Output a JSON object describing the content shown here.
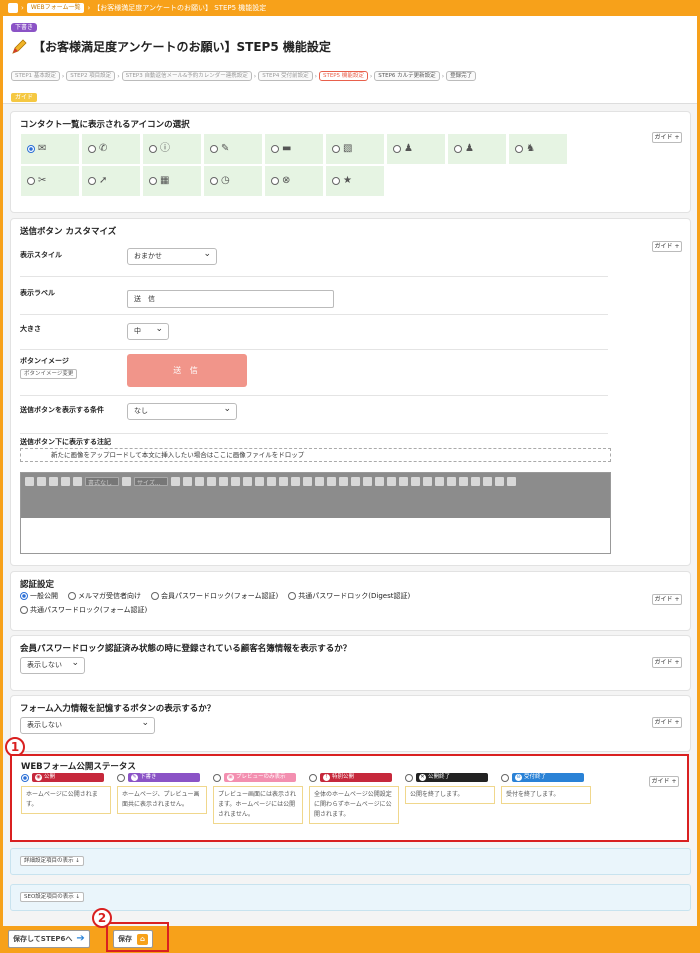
{
  "breadcrumb": {
    "link": "WEBフォーム一覧",
    "current": "【お客様満足度アンケートのお願い】 STEP5 機能設定"
  },
  "header": {
    "badge": "下書き",
    "title": "【お客様満足度アンケートのお願い】STEP5 機能設定",
    "steps": [
      "STEP1 基本設定",
      "STEP2 項目設定",
      "STEP3 自動返信メール&予約カレンダー連携設定",
      "STEP4 受付前設定",
      "STEP5 機能設定",
      "STEP6 カルテ更新設定",
      "登録完了"
    ],
    "guide": "ガイド"
  },
  "guide_label": "ガイド +",
  "icon_section": {
    "title": "コンタクト一覧に表示されるアイコンの選択",
    "icons": [
      "mail-icon",
      "phone-icon",
      "notice-icon",
      "pencil-icon",
      "image-icon",
      "memo-icon",
      "person-icon",
      "person2-icon",
      "people-icon",
      "puzzle-icon",
      "arrow-icon",
      "calendar-icon",
      "clock-icon",
      "cross-circle-icon",
      "star-icon"
    ],
    "glyphs": [
      "✉",
      "✆",
      "ⓘ",
      "✎",
      "▬",
      "▧",
      "♟",
      "♟",
      "♞",
      "✂",
      "➚",
      "▦",
      "◷",
      "⊗",
      "★"
    ],
    "selected_index": 0
  },
  "button_section": {
    "title": "送信ボタン カスタマイズ",
    "style_label": "表示スタイル",
    "style_value": "おまかせ",
    "text_label": "表示ラベル",
    "text_value": "送　信",
    "size_label": "大きさ",
    "size_value": "中",
    "image_label": "ボタンイメージ",
    "image_button": "ボタンイメージ変更",
    "preview": "送 信",
    "cond_label": "送信ボタンを表示する条件",
    "cond_value": "なし",
    "note_label": "送信ボタン下に表示する注記",
    "upload_text": "新たに画像をアップロードして本文に挿入したい場合はここに画像ファイルをドロップ",
    "font_placeholder": "書式なし",
    "size_placeholder": "サイズ..."
  },
  "auth_section": {
    "title": "認証設定",
    "options": [
      "一般公開",
      "メルマガ受信者向け",
      "会員パスワードロック(フォーム認証)",
      "共通パスワードロック(Digest認証)",
      "共通パスワードロック(フォーム認証)"
    ],
    "selected_index": 0
  },
  "member_section": {
    "title": "会員パスワードロック認証済み状態の時に登録されている顧客名簿情報を表示するか？",
    "value": "表示しない"
  },
  "remember_section": {
    "title": "フォーム入力情報を記憶するボタンの表示するか？",
    "value": "表示しない"
  },
  "status_section": {
    "callout": "1",
    "title": "WEBフォーム公開ステータス",
    "options": [
      {
        "label": "公開",
        "color": "#c6283b",
        "desc": "ホームページに公開されます。"
      },
      {
        "label": "下書き",
        "color": "#8b53c6",
        "desc": "ホームページ、プレビュー画面共に表示されません。"
      },
      {
        "label": "プレビューのみ表示",
        "color": "#f38fb0",
        "desc": "プレビュー画面には表示されます。ホームページには公開されません。"
      },
      {
        "label": "特別公開",
        "color": "#c6283b",
        "desc": "全体のホームページ公開設定に関わらずホームページに公開されます。"
      },
      {
        "label": "公開終了",
        "color": "#222222",
        "desc": "公開を終了します。"
      },
      {
        "label": "受付終了",
        "color": "#2a82d6",
        "desc": "受付を終了します。"
      }
    ],
    "selected_index": 0
  },
  "detail_buttons": [
    "詳細設定項目の表示 ↓",
    "SEO設定項目の表示 ↓"
  ],
  "footer": {
    "callout": "2",
    "save_next": "保存してSTEP6へ",
    "save": "保存"
  }
}
